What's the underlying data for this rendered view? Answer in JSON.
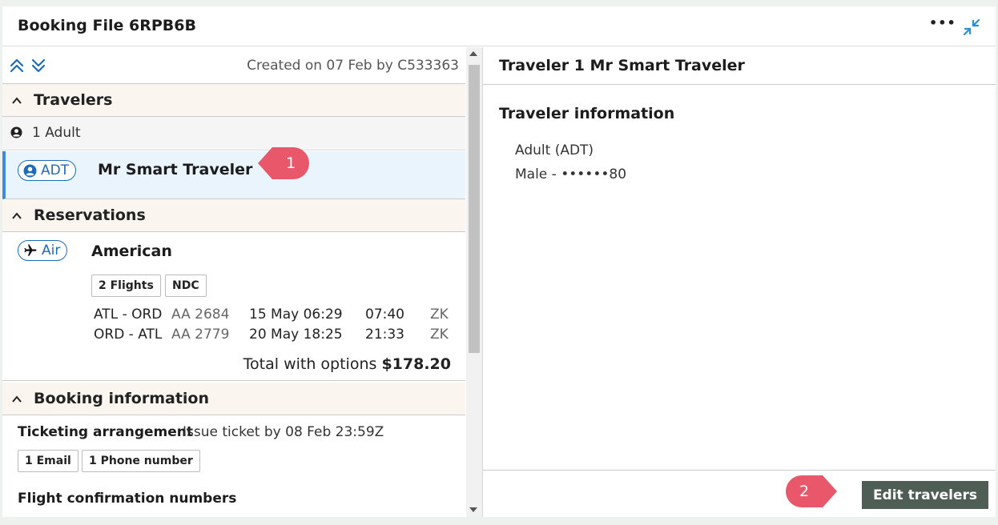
{
  "window": {
    "title": "Booking File 6RPB6B",
    "more_label": "•••",
    "collapse_icon": "collapse-arrows-icon"
  },
  "toolbar": {
    "created": "Created on 07 Feb by C533363",
    "expand_icon": "double-chevron-up-icon",
    "collapse_icon": "double-chevron-down-icon"
  },
  "sections": {
    "travelers": "Travelers",
    "reservations": "Reservations",
    "booking_info": "Booking information"
  },
  "travelers": {
    "count_label": "1 Adult",
    "items": [
      {
        "type": "ADT",
        "name": "Mr Smart Traveler"
      }
    ]
  },
  "reservation": {
    "type": "Air",
    "airline": "American",
    "tags": [
      "2 Flights",
      "NDC"
    ],
    "flights": [
      {
        "route": "ATL - ORD",
        "number": "AA 2684",
        "date": "15 May 06:29",
        "arrival": "07:40",
        "zone": "ZK"
      },
      {
        "route": "ORD - ATL",
        "number": "AA 2779",
        "date": "20 May 18:25",
        "arrival": "21:33",
        "zone": "ZK"
      }
    ],
    "total_label": "Total with options",
    "total_value": "$178.20"
  },
  "booking_info": {
    "ticketing_label": "Ticketing arrangement",
    "ticketing_value": "Issue ticket by 08 Feb 23:59Z",
    "tags": [
      "1 Email",
      "1 Phone number"
    ],
    "flight_conf_label": "Flight confirmation numbers"
  },
  "detail": {
    "title": "Traveler 1 Mr Smart Traveler",
    "section_title": "Traveler information",
    "type_line": "Adult (ADT)",
    "info_line": "Male  -  ••••••80",
    "edit_button": "Edit travelers"
  },
  "callouts": [
    "1",
    "2"
  ],
  "colors": {
    "accent_blue": "#1e6bb8",
    "selected_bg": "#eaf4fc",
    "section_bg": "#fbf5f0",
    "callout": "#e8586a",
    "button": "#4e5e54"
  }
}
